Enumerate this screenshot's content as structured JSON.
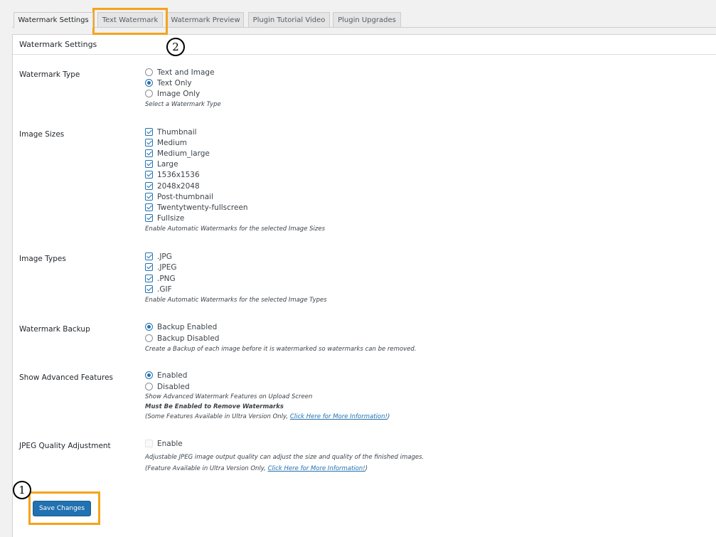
{
  "tabs": [
    {
      "label": "Watermark Settings",
      "active": true
    },
    {
      "label": "Text Watermark",
      "active": false
    },
    {
      "label": "Watermark Preview",
      "active": false
    },
    {
      "label": "Plugin Tutorial Video",
      "active": false
    },
    {
      "label": "Plugin Upgrades",
      "active": false
    }
  ],
  "panel": {
    "title": "Watermark Settings"
  },
  "watermark_type": {
    "label": "Watermark Type",
    "options": [
      {
        "label": "Text and Image",
        "selected": false
      },
      {
        "label": "Text Only",
        "selected": true
      },
      {
        "label": "Image Only",
        "selected": false
      }
    ],
    "description": "Select a Watermark Type"
  },
  "image_sizes": {
    "label": "Image Sizes",
    "options": [
      {
        "label": "Thumbnail",
        "checked": true
      },
      {
        "label": "Medium",
        "checked": true
      },
      {
        "label": "Medium_large",
        "checked": true
      },
      {
        "label": "Large",
        "checked": true
      },
      {
        "label": "1536x1536",
        "checked": true
      },
      {
        "label": "2048x2048",
        "checked": true
      },
      {
        "label": "Post-thumbnail",
        "checked": true
      },
      {
        "label": "Twentytwenty-fullscreen",
        "checked": true
      },
      {
        "label": "Fullsize",
        "checked": true
      }
    ],
    "description": "Enable Automatic Watermarks for the selected Image Sizes"
  },
  "image_types": {
    "label": "Image Types",
    "options": [
      {
        "label": ".JPG",
        "checked": true
      },
      {
        "label": ".JPEG",
        "checked": true
      },
      {
        "label": ".PNG",
        "checked": true
      },
      {
        "label": ".GIF",
        "checked": true
      }
    ],
    "description": "Enable Automatic Watermarks for the selected Image Types"
  },
  "watermark_backup": {
    "label": "Watermark Backup",
    "options": [
      {
        "label": "Backup Enabled",
        "selected": true
      },
      {
        "label": "Backup Disabled",
        "selected": false
      }
    ],
    "description": "Create a Backup of each image before it is watermarked so watermarks can be removed."
  },
  "advanced_features": {
    "label": "Show Advanced Features",
    "options": [
      {
        "label": "Enabled",
        "selected": true
      },
      {
        "label": "Disabled",
        "selected": false
      }
    ],
    "description": "Show Advanced Watermark Features on Upload Screen",
    "note_bold": "Must Be Enabled to Remove Watermarks",
    "note_prefix": "(Some Features Available in Ultra Version Only, ",
    "note_link": "Click Here for More Information!",
    "note_suffix": ")"
  },
  "jpeg_quality": {
    "label": "JPEG Quality Adjustment",
    "option_label": "Enable",
    "checked": false,
    "description": "Adjustable JPEG image output quality can adjust the size and quality of the finished images.",
    "note_prefix": "(Feature Available in Ultra Version Only, ",
    "note_link": "Click Here for More Information!",
    "note_suffix": ")"
  },
  "save_button": {
    "label": "Save Changes"
  },
  "annotations": {
    "step_1": "1",
    "step_2": "2",
    "highlight_color": "#f5a31b"
  },
  "colors": {
    "accent": "#2271b1",
    "background": "#f1f1f1",
    "panel": "#ffffff"
  }
}
